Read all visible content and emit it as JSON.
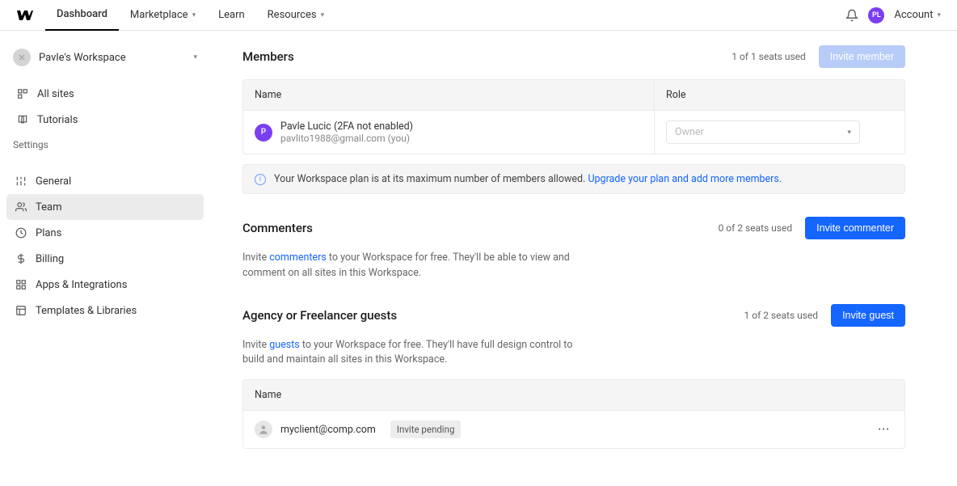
{
  "topnav": {
    "items": [
      "Dashboard",
      "Marketplace",
      "Learn",
      "Resources"
    ],
    "account_label": "Account",
    "avatar_initials": "PL"
  },
  "workspace": {
    "name": "Pavle's Workspace"
  },
  "sidebar": {
    "primary": [
      {
        "label": "All sites"
      },
      {
        "label": "Tutorials"
      }
    ],
    "settings_heading": "Settings",
    "settings": [
      {
        "label": "General"
      },
      {
        "label": "Team"
      },
      {
        "label": "Plans"
      },
      {
        "label": "Billing"
      },
      {
        "label": "Apps & Integrations"
      },
      {
        "label": "Templates & Libraries"
      }
    ]
  },
  "members": {
    "title": "Members",
    "seats": "1 of 1 seats used",
    "invite_btn": "Invite member",
    "col_name": "Name",
    "col_role": "Role",
    "row": {
      "avatar_letter": "P",
      "name": "Pavle Lucic",
      "tfa": "(2FA not enabled)",
      "email": "pavlito1988@gmail.com",
      "you": "(you)",
      "role": "Owner"
    },
    "banner_text": "Your Workspace plan is at its maximum number of members allowed.",
    "banner_link": "Upgrade your plan and add more members."
  },
  "commenters": {
    "title": "Commenters",
    "seats": "0 of 2 seats used",
    "invite_btn": "Invite commenter",
    "desc_pre": "Invite ",
    "desc_link": "commenters",
    "desc_post": " to your Workspace for free. They'll be able to view and comment on all sites in this Workspace."
  },
  "guests": {
    "title": "Agency or Freelancer guests",
    "seats": "1 of 2 seats used",
    "invite_btn": "Invite guest",
    "desc_pre": "Invite ",
    "desc_link": "guests",
    "desc_post": " to your Workspace for free. They'll have full design control to build and maintain all sites in this Workspace.",
    "col_name": "Name",
    "row": {
      "email": "myclient@comp.com",
      "status": "Invite pending"
    }
  }
}
